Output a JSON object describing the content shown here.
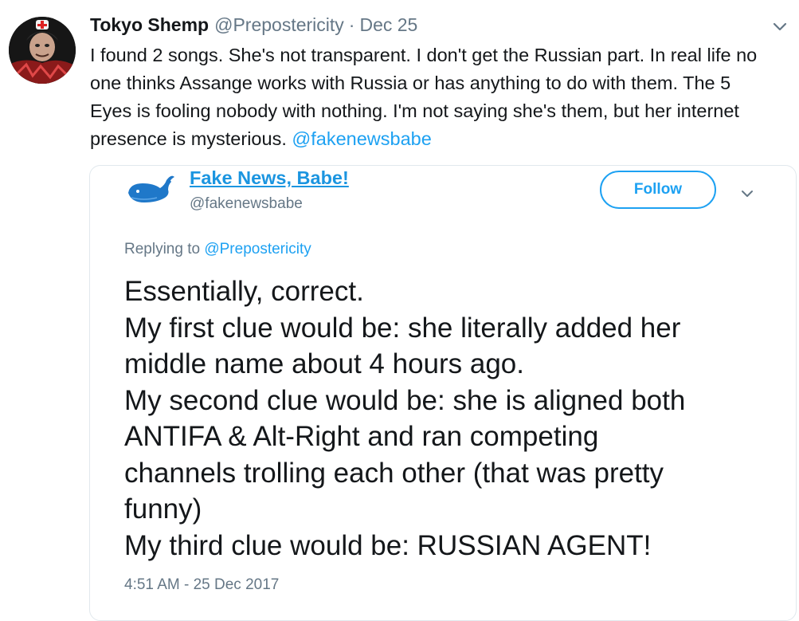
{
  "tweet": {
    "display_name": "Tokyo Shemp",
    "handle": "@Prepostericity",
    "separator": "·",
    "date": "Dec 25",
    "avatar_icon": "avatar-photo",
    "menu_icon": "chevron-down-icon",
    "text_lines": [
      "I found 2 songs. She's not transparent. I don't get the Russian part. In real life no",
      "one thinks Assange works with Russia or has anything to do with them. The 5",
      "Eyes is fooling nobody with nothing. I'm not saying she's them, but her internet",
      "presence is mysterious. "
    ],
    "mention": "@fakenewsbabe"
  },
  "quoted_tweet": {
    "display_name": "Fake News, Babe!",
    "handle": "@fakenewsbabe",
    "avatar_icon": "whale-icon",
    "follow_label": "Follow",
    "menu_icon": "chevron-down-icon",
    "replying_prefix": "Replying to ",
    "replying_to": "@Prepostericity",
    "text_lines": [
      "Essentially, correct.",
      "My first clue would be: she literally added her",
      "middle name about 4 hours ago.",
      "My second clue would be: she is aligned both",
      "ANTIFA & Alt-Right and ran competing",
      "channels trolling each other (that was pretty",
      "funny)",
      "My third clue would be: RUSSIAN AGENT!"
    ],
    "timestamp": "4:51 AM - 25 Dec 2017"
  },
  "colors": {
    "link": "#1da1f2",
    "secondary_text": "#657786",
    "primary_text": "#14171a",
    "border": "#e1e8ed"
  }
}
